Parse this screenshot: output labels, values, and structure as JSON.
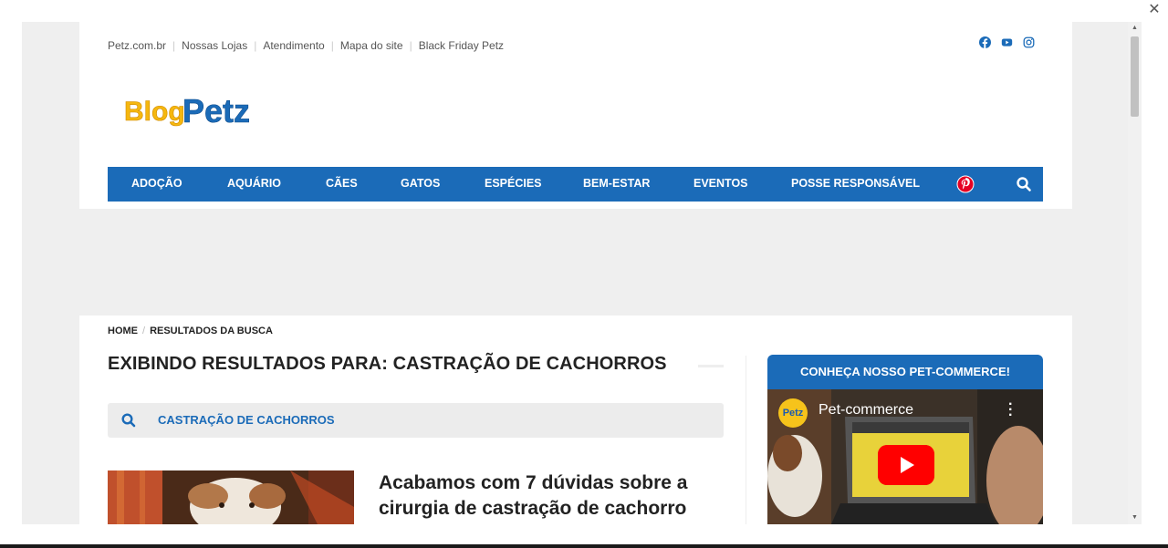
{
  "top_links": [
    "Petz.com.br",
    "Nossas Lojas",
    "Atendimento",
    "Mapa do site",
    "Black Friday Petz"
  ],
  "social_icons": [
    "facebook-icon",
    "youtube-icon",
    "instagram-icon"
  ],
  "logo": {
    "part1": "Blog",
    "part2": "Petz"
  },
  "nav_items": [
    "ADOÇÃO",
    "AQUÁRIO",
    "CÃES",
    "GATOS",
    "ESPÉCIES",
    "BEM-ESTAR",
    "EVENTOS",
    "POSSE RESPONSÁVEL"
  ],
  "breadcrumb": {
    "home": "HOME",
    "current": "RESULTADOS DA BUSCA"
  },
  "results_title": "EXIBINDO RESULTADOS PARA: CASTRAÇÃO DE CACHORROS",
  "search": {
    "value": "CASTRAÇÃO DE CACHORROS"
  },
  "article": {
    "title": "Acabamos com 7 dúvidas sobre a cirurgia de castração de cachorro"
  },
  "widget": {
    "title": "CONHEÇA NOSSO PET-COMMERCE!",
    "video_title": "Pet-commerce",
    "channel_logo": "Petz"
  },
  "colors": {
    "brand_blue": "#1b6bb8",
    "pinterest_red": "#e60023",
    "youtube_red": "#ff0000"
  }
}
